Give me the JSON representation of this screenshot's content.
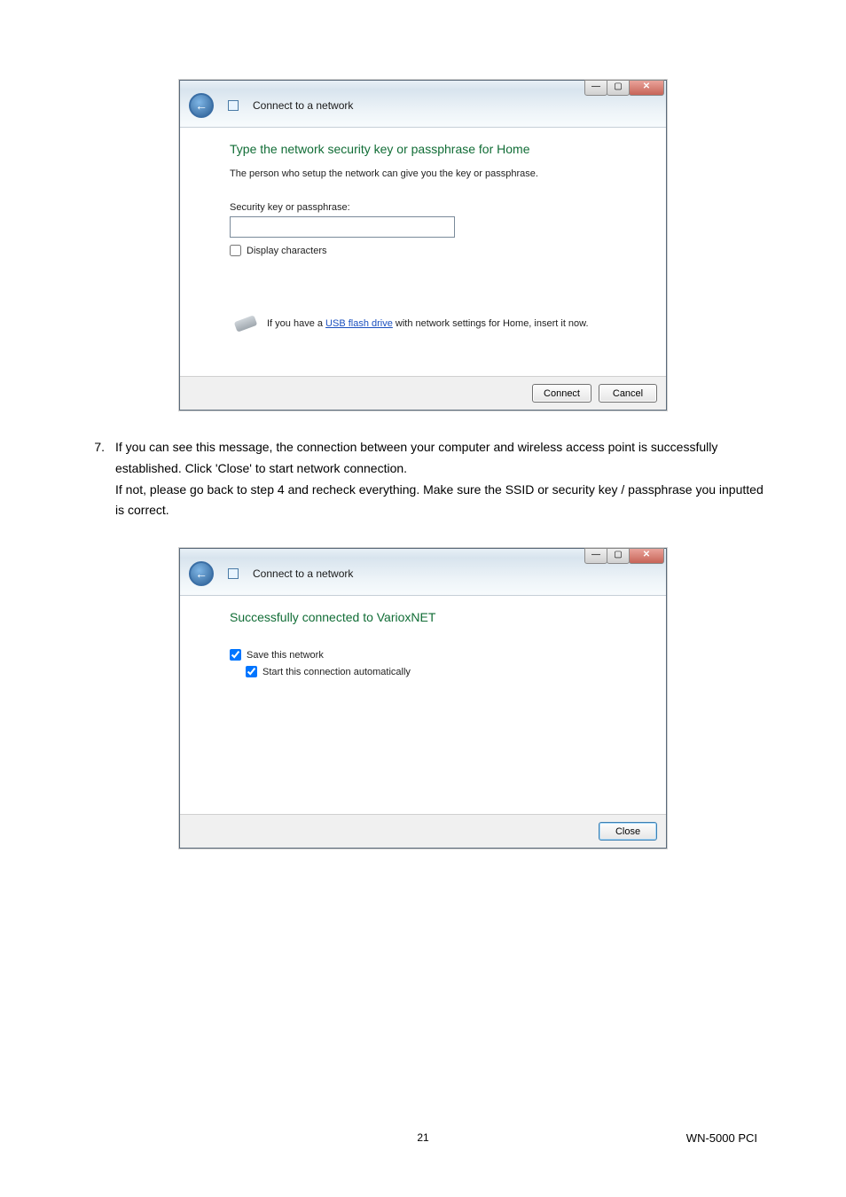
{
  "dialog1": {
    "title": "Connect to a network",
    "heading": "Type the network security key or passphrase for Home",
    "subtext": "The person who setup the network can give you the key or passphrase.",
    "field_label": "Security key or passphrase:",
    "input_value": "",
    "display_chars_label": "Display characters",
    "usb_pre": "If you have a ",
    "usb_link": "USB flash drive",
    "usb_post": " with network settings for Home, insert it now.",
    "connect": "Connect",
    "cancel": "Cancel"
  },
  "step": {
    "num": "7.",
    "line1": "If you can see this message, the connection between your computer and wireless access point is successfully established. Click 'Close' to start network connection.",
    "line2": "If not, please go back to step 4 and recheck everything. Make sure the SSID or security key / passphrase you inputted is correct."
  },
  "dialog2": {
    "title": "Connect to a network",
    "heading": "Successfully connected to VarioxNET",
    "save_label": "Save this network",
    "auto_label": "Start this connection automatically",
    "close": "Close"
  },
  "footer": {
    "page": "21",
    "model": "WN-5000 PCI"
  }
}
